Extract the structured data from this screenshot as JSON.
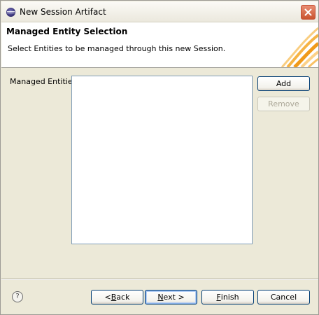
{
  "window": {
    "title": "New Session Artifact",
    "icon": "eclipse-app-icon",
    "close_icon": "close-icon"
  },
  "header": {
    "title": "Managed Entity Selection",
    "description": "Select Entities to be managed through this new Session."
  },
  "managed_entities": {
    "label": "Managed Entities",
    "items": []
  },
  "side_buttons": {
    "add": "Add",
    "remove": "Remove",
    "remove_enabled": false
  },
  "footer": {
    "help_symbol": "?",
    "back": {
      "prefix": "< ",
      "mnemonic": "B",
      "rest": "ack"
    },
    "next": {
      "mnemonic": "N",
      "rest": "ext >"
    },
    "finish": {
      "mnemonic": "F",
      "rest": "inish"
    },
    "cancel": "Cancel"
  },
  "colors": {
    "accent_orange": "#f5a623",
    "focus_blue": "#316ac5"
  }
}
